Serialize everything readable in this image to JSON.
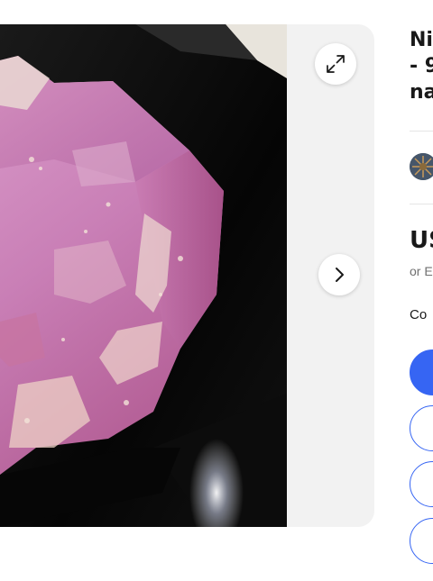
{
  "viewer": {
    "photo_alt": "Pink ruby crystal specimen on black background",
    "expand_icon": "expand-arrows-icon",
    "next_icon": "chevron-right-icon"
  },
  "listing": {
    "title_lines": [
      "Ni",
      "- 9",
      "na"
    ],
    "price": "US",
    "price_sub": "or E",
    "condition": "Co"
  },
  "buttons": {
    "primary_label": "",
    "secondary_1_label": "",
    "secondary_2_label": "",
    "secondary_3_label": ""
  },
  "colors": {
    "accent": "#3665f3",
    "text": "#191919",
    "muted": "#707070",
    "viewer_bg": "#f2f2f2"
  }
}
